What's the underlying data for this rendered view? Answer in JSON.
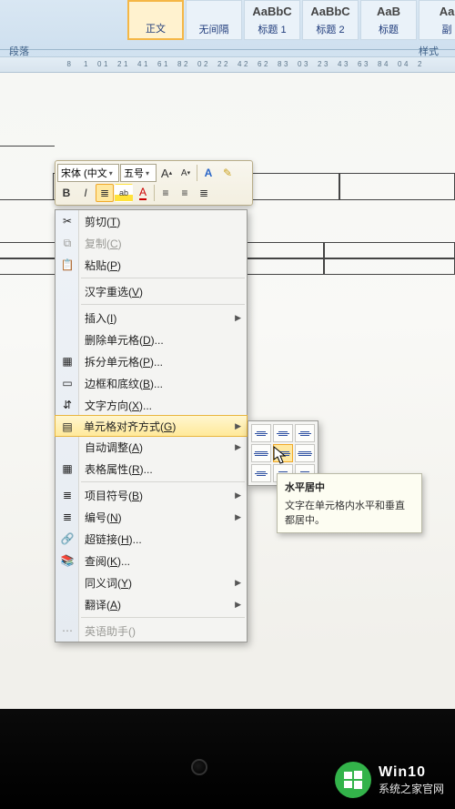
{
  "ribbon": {
    "styles": [
      {
        "sample": "",
        "label": "正文",
        "active": true
      },
      {
        "sample": "",
        "label": "无间隔",
        "active": false
      },
      {
        "sample": "AaBbC",
        "label": "标题 1",
        "active": false
      },
      {
        "sample": "AaBbC",
        "label": "标题 2",
        "active": false
      },
      {
        "sample": "AaB",
        "label": "标题",
        "active": false
      },
      {
        "sample": "Aa",
        "label": "副",
        "active": false
      }
    ],
    "section_paragraph": "段落",
    "section_style": "样式"
  },
  "ruler": {
    "numbers": [
      "8",
      "10",
      "12",
      "14",
      "16",
      "18",
      "20",
      "22",
      "24",
      "26",
      "28",
      "30",
      "32",
      "34",
      "36",
      "38",
      "40",
      "42"
    ]
  },
  "mini_toolbar": {
    "font_name": "宋体 (中文",
    "font_size": "五号",
    "grow": "A",
    "shrink": "A",
    "style_a": "A",
    "highlighter": "✎",
    "bold": "B",
    "italic": "I",
    "center_icon": "≣",
    "highlight_icon": "ab",
    "font_color": "A",
    "indent_dec": "≡",
    "indent_inc": "≡",
    "bullets": "≣"
  },
  "context_menu": {
    "items": [
      {
        "key": "cut",
        "label_pre": "剪切(",
        "hot": "T",
        "label_post": ")",
        "icon": "✂",
        "disabled": false
      },
      {
        "key": "copy",
        "label_pre": "复制(",
        "hot": "C",
        "label_post": ")",
        "icon": "⧉",
        "disabled": true
      },
      {
        "key": "paste",
        "label_pre": "粘贴(",
        "hot": "P",
        "label_post": ")",
        "icon": "📋",
        "disabled": false
      },
      {
        "sep": true
      },
      {
        "key": "reconvert",
        "label_pre": "汉字重选(",
        "hot": "V",
        "label_post": ")",
        "disabled": false
      },
      {
        "sep": true
      },
      {
        "key": "insert",
        "label_pre": "插入(",
        "hot": "I",
        "label_post": ")",
        "submenu": true
      },
      {
        "key": "delcells",
        "label_pre": "删除单元格(",
        "hot": "D",
        "label_post": ")..."
      },
      {
        "key": "splitcells",
        "label_pre": "拆分单元格(",
        "hot": "P",
        "label_post": ")...",
        "icon": "▦"
      },
      {
        "key": "borders",
        "label_pre": "边框和底纹(",
        "hot": "B",
        "label_post": ")...",
        "icon": "▭"
      },
      {
        "key": "textdir",
        "label_pre": "文字方向(",
        "hot": "X",
        "label_post": ")...",
        "icon": "⇵"
      },
      {
        "key": "cellalign",
        "label_pre": "单元格对齐方式(",
        "hot": "G",
        "label_post": ")",
        "icon": "▤",
        "submenu": true,
        "highlight": true
      },
      {
        "key": "autofit",
        "label_pre": "自动调整(",
        "hot": "A",
        "label_post": ")",
        "submenu": true
      },
      {
        "key": "tableprops",
        "label_pre": "表格属性(",
        "hot": "R",
        "label_post": ")...",
        "icon": "▦"
      },
      {
        "sep": true
      },
      {
        "key": "bullets",
        "label_pre": "项目符号(",
        "hot": "B",
        "label_post": ")",
        "icon": "≣",
        "submenu": true
      },
      {
        "key": "numbering",
        "label_pre": "编号(",
        "hot": "N",
        "label_post": ")",
        "icon": "≣",
        "submenu": true
      },
      {
        "key": "hyperlink",
        "label_pre": "超链接(",
        "hot": "H",
        "label_post": ")...",
        "icon": "🔗"
      },
      {
        "key": "lookup",
        "label_pre": "查阅(",
        "hot": "K",
        "label_post": ")...",
        "icon": "📚"
      },
      {
        "key": "synonyms",
        "label_pre": "同义词(",
        "hot": "Y",
        "label_post": ")",
        "submenu": true
      },
      {
        "key": "translate",
        "label_pre": "翻译(",
        "hot": "A",
        "label_post": ")",
        "submenu": true
      },
      {
        "sep": true
      },
      {
        "key": "englishassist",
        "label_pre": "英语助手(",
        "hot": "",
        "label_post": ")",
        "icon": "⋯",
        "disabled": true
      }
    ]
  },
  "tooltip": {
    "title": "水平居中",
    "body": "文字在单元格内水平和垂直都居中。"
  },
  "watermark": {
    "line1": "Win10",
    "line2": "系统之家官网"
  },
  "colors": {
    "accent": "#f5b746",
    "menu_hl": "#ffe99a"
  },
  "chart_data": null
}
